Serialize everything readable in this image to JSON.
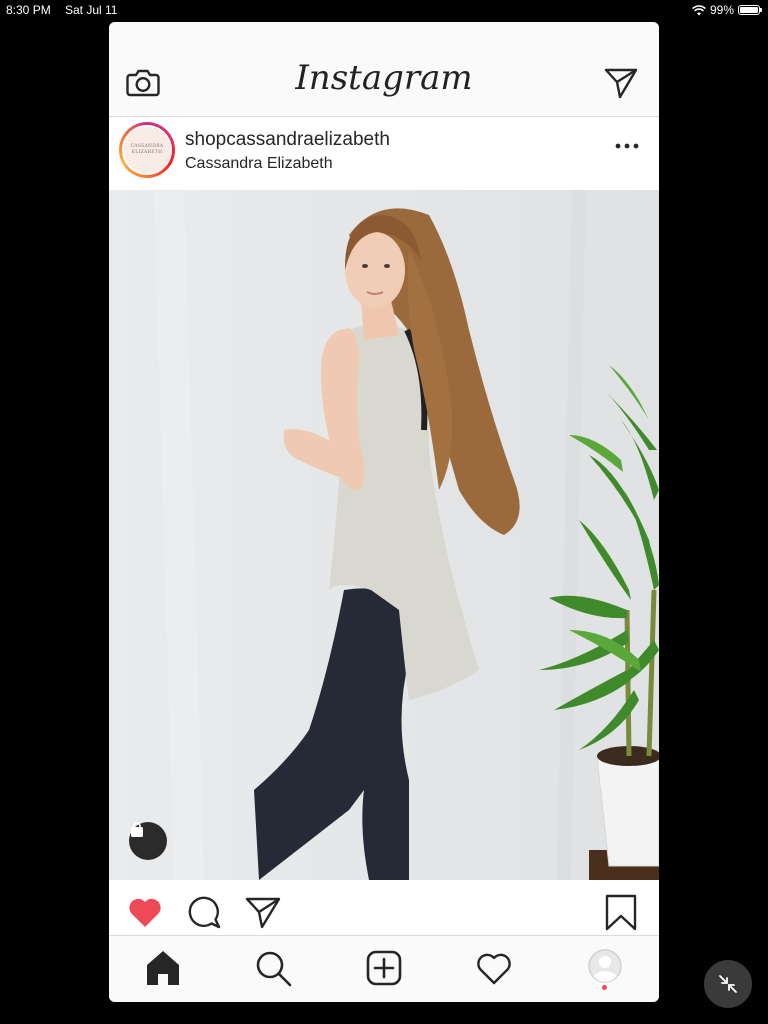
{
  "status_bar": {
    "time": "8:30 PM",
    "date": "Sat Jul 11",
    "battery_percent": "99%",
    "battery_level": 0.99
  },
  "header": {
    "logo": "Instagram",
    "left_icon": "camera-icon",
    "right_icon": "direct-send-icon"
  },
  "post": {
    "avatar_text": [
      "CASSANDRA",
      "ELIZABETH"
    ],
    "username": "shopcassandraelizabeth",
    "full_name": "Cassandra Elizabeth",
    "menu_icon": "more-options-icon",
    "photo_icon": "shopping-bag-icon",
    "liked": true
  },
  "actions": {
    "icons": [
      "heart-filled-icon",
      "comment-icon",
      "share-icon",
      "bookmark-icon"
    ],
    "like_color": "#ed4956"
  },
  "tab_bar": {
    "items": [
      "home-icon",
      "search-icon",
      "new-post-icon",
      "activity-icon",
      "profile-icon"
    ],
    "active": "home-icon",
    "notification_dot_color": "#ed4956"
  }
}
